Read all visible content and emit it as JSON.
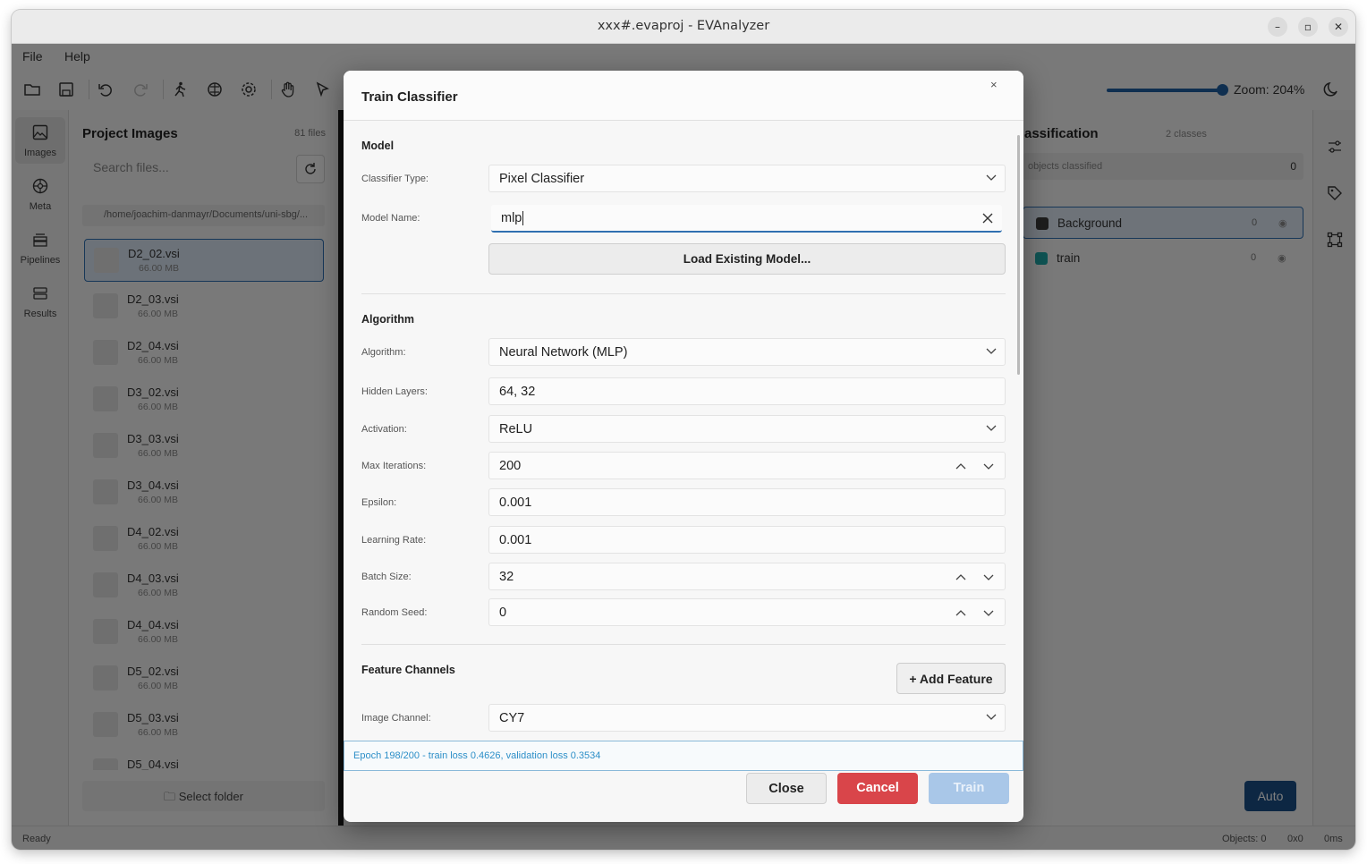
{
  "window": {
    "title": "xxx#.evaproj - EVAnalyzer"
  },
  "menu": {
    "file": "File",
    "help": "Help"
  },
  "toolbar": {
    "zoom_label": "Zoom: 204%",
    "zoom_level": 0.95
  },
  "sidebar": {
    "items": [
      {
        "label": "Images",
        "icon": "image-icon"
      },
      {
        "label": "Meta",
        "icon": "meta-icon"
      },
      {
        "label": "Pipelines",
        "icon": "pipelines-icon"
      },
      {
        "label": "Results",
        "icon": "results-icon"
      }
    ]
  },
  "project": {
    "title": "Project Images",
    "count": "81 files",
    "search_placeholder": "Search files...",
    "path": "/home/joachim-danmayr/Documents/uni-sbg/...",
    "files": [
      {
        "name": "D2_02.vsi",
        "size": "66.00 MB"
      },
      {
        "name": "D2_03.vsi",
        "size": "66.00 MB"
      },
      {
        "name": "D2_04.vsi",
        "size": "66.00 MB"
      },
      {
        "name": "D3_02.vsi",
        "size": "66.00 MB"
      },
      {
        "name": "D3_03.vsi",
        "size": "66.00 MB"
      },
      {
        "name": "D3_04.vsi",
        "size": "66.00 MB"
      },
      {
        "name": "D4_02.vsi",
        "size": "66.00 MB"
      },
      {
        "name": "D4_03.vsi",
        "size": "66.00 MB"
      },
      {
        "name": "D4_04.vsi",
        "size": "66.00 MB"
      },
      {
        "name": "D5_02.vsi",
        "size": "66.00 MB"
      },
      {
        "name": "D5_03.vsi",
        "size": "66.00 MB"
      },
      {
        "name": "D5_04.vsi",
        "size": ""
      }
    ],
    "select_folder": "Select folder"
  },
  "classification": {
    "title": "assification",
    "count": "2 classes",
    "objects_label": "objects classified",
    "objects_count": "0",
    "classes": [
      {
        "name": "Background",
        "count": "0",
        "color": "#3a3a3a"
      },
      {
        "name": "train",
        "count": "0",
        "color": "#1fa6a6"
      }
    ],
    "auto_button": "Auto"
  },
  "status": {
    "left": "Ready",
    "objects": "Objects: 0",
    "size": "0x0",
    "time": "0ms"
  },
  "dialog": {
    "title": "Train Classifier",
    "close_x": "×",
    "model_section": "Model",
    "classifier_type_label": "Classifier Type:",
    "classifier_type_value": "Pixel Classifier",
    "model_name_label": "Model Name:",
    "model_name_value": "mlp",
    "load_model_button": "Load Existing Model...",
    "algorithm_section": "Algorithm",
    "algorithm_label": "Algorithm:",
    "algorithm_value": "Neural Network (MLP)",
    "hidden_layers_label": "Hidden Layers:",
    "hidden_layers_value": "64, 32",
    "activation_label": "Activation:",
    "activation_value": "ReLU",
    "max_iter_label": "Max Iterations:",
    "max_iter_value": "200",
    "epsilon_label": "Epsilon:",
    "epsilon_value": "0.001",
    "learning_rate_label": "Learning Rate:",
    "learning_rate_value": "0.001",
    "batch_size_label": "Batch Size:",
    "batch_size_value": "32",
    "random_seed_label": "Random Seed:",
    "random_seed_value": "0",
    "feature_section": "Feature Channels",
    "add_feature_button": "+ Add Feature",
    "image_channel_label": "Image Channel:",
    "image_channel_value": "CY7",
    "progress_text": "Epoch 198/200 - train loss 0.4626, validation loss 0.3534",
    "close_button": "Close",
    "cancel_button": "Cancel",
    "train_button": "Train",
    "colors": {
      "cancel": "#d9454a",
      "train": "#a9c7e8",
      "accent": "#2f6fb0"
    }
  }
}
